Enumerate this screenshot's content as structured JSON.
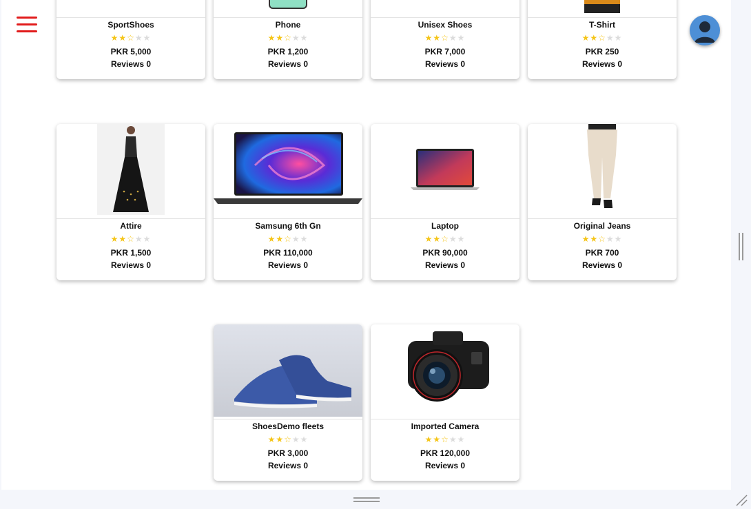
{
  "header": {
    "menu_icon": "hamburger-menu-icon",
    "avatar_icon": "user-avatar-icon"
  },
  "products": [
    {
      "name": "SportShoes",
      "rating": 2.5,
      "price": "PKR 5,000",
      "reviews": "Reviews 0",
      "image": "sport-shoes-image"
    },
    {
      "name": "Phone",
      "rating": 2.5,
      "price": "PKR 1,200",
      "reviews": "Reviews 0",
      "image": "phone-image"
    },
    {
      "name": "Unisex Shoes",
      "rating": 2.5,
      "price": "PKR 7,000",
      "reviews": "Reviews 0",
      "image": "unisex-shoes-image"
    },
    {
      "name": "T-Shirt",
      "rating": 2.5,
      "price": "PKR 250",
      "reviews": "Reviews 0",
      "image": "t-shirt-image"
    },
    {
      "name": "Attire",
      "rating": 2.5,
      "price": "PKR 1,500",
      "reviews": "Reviews 0",
      "image": "attire-dress-image"
    },
    {
      "name": "Samsung 6th Gn",
      "rating": 2.5,
      "price": "PKR 110,000",
      "reviews": "Reviews 0",
      "image": "laptop-swirl-image"
    },
    {
      "name": "Laptop",
      "rating": 2.5,
      "price": "PKR 90,000",
      "reviews": "Reviews 0",
      "image": "macbook-image"
    },
    {
      "name": "Original Jeans",
      "rating": 2.5,
      "price": "PKR 700",
      "reviews": "Reviews 0",
      "image": "jeans-image"
    },
    {
      "name": "ShoesDemo fleets",
      "rating": 2.5,
      "price": "PKR 3,000",
      "reviews": "Reviews 0",
      "image": "blue-sneakers-image"
    },
    {
      "name": "Imported Camera",
      "rating": 2.5,
      "price": "PKR 120,000",
      "reviews": "Reviews 0",
      "image": "dslr-camera-image"
    }
  ],
  "colors": {
    "star_on": "#f5c518",
    "star_off": "#dcdcdc",
    "menu": "#e11b1b",
    "avatar": "#4d8fd6"
  }
}
